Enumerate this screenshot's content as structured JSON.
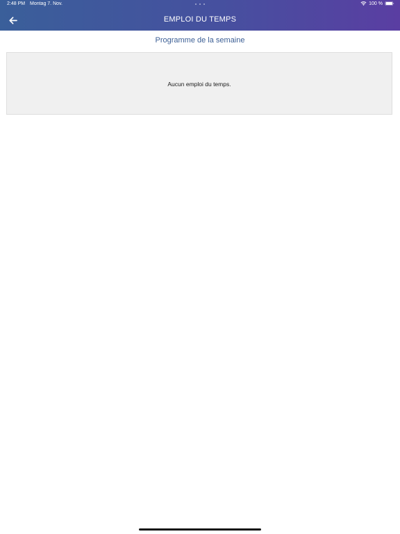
{
  "status_bar": {
    "time": "2:48 PM",
    "date": "Montag 7. Nov.",
    "battery": "100 %"
  },
  "header": {
    "title": "EMPLOI DU TEMPS",
    "back_icon": "arrow-left-icon"
  },
  "main": {
    "section_title": "Programme de la semaine",
    "empty_message": "Aucun emploi du temps."
  },
  "colors": {
    "header_gradient_start": "#3a5f9a",
    "header_gradient_end": "#5a3ea2",
    "section_title": "#3c5f95",
    "empty_box_bg": "#f0f0f0"
  }
}
